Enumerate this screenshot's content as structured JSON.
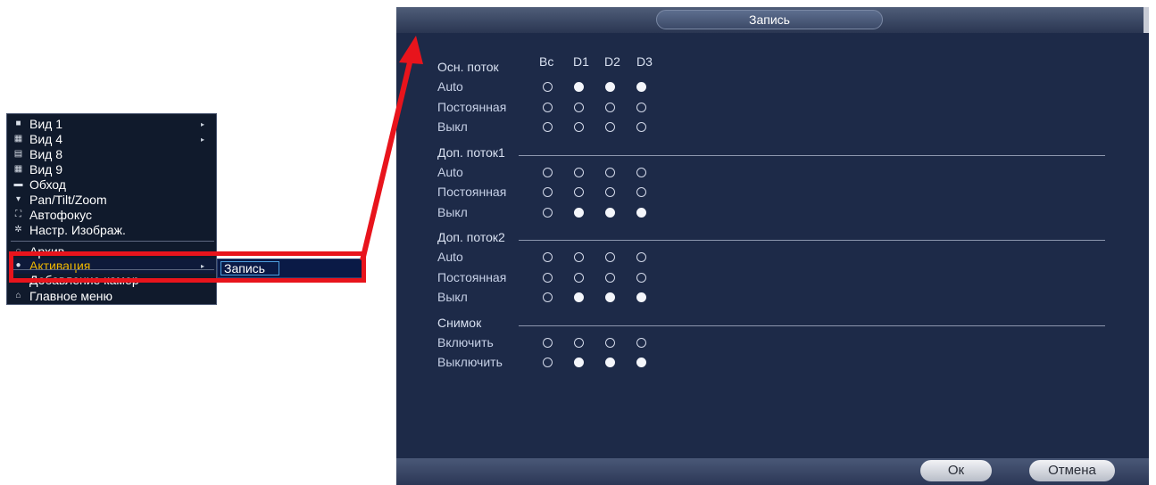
{
  "context_menu": {
    "items": [
      {
        "icon": "grid-1-icon",
        "label": "Вид 1",
        "submenu": true
      },
      {
        "icon": "grid-4-icon",
        "label": "Вид 4",
        "submenu": true
      },
      {
        "icon": "grid-8-icon",
        "label": "Вид 8",
        "submenu": false
      },
      {
        "icon": "grid-9-icon",
        "label": "Вид 9",
        "submenu": false
      },
      {
        "icon": "tour-icon",
        "label": "Обход",
        "submenu": false
      },
      {
        "icon": "ptz-icon",
        "label": "Pan/Tilt/Zoom",
        "submenu": false
      },
      {
        "icon": "autofocus-icon",
        "label": "Автофокус",
        "submenu": false
      },
      {
        "icon": "image-settings-icon",
        "label": "Настр. Изображ.",
        "submenu": false
      },
      {
        "icon": "search-icon",
        "label": "Архив",
        "submenu": false
      },
      {
        "icon": "activation-icon",
        "label": "Активация",
        "submenu": true
      },
      {
        "icon": "add-camera-icon",
        "label": "Добавление камер",
        "submenu": false
      },
      {
        "icon": "home-icon",
        "label": "Главное меню",
        "submenu": false
      }
    ],
    "highlighted_index": 9,
    "submenu": {
      "label": "Запись"
    }
  },
  "dialog": {
    "title": "Запись",
    "columns": [
      "Вс",
      "D1",
      "D2",
      "D3"
    ],
    "sections": [
      {
        "label": "Осн. поток",
        "rows": [
          {
            "label": "Auto",
            "values": [
              false,
              true,
              true,
              true
            ]
          },
          {
            "label": "Постоянная",
            "values": [
              false,
              false,
              false,
              false
            ]
          },
          {
            "label": "Выкл",
            "values": [
              false,
              false,
              false,
              false
            ]
          }
        ]
      },
      {
        "label": "Доп. поток1",
        "rows": [
          {
            "label": "Auto",
            "values": [
              false,
              false,
              false,
              false
            ]
          },
          {
            "label": "Постоянная",
            "values": [
              false,
              false,
              false,
              false
            ]
          },
          {
            "label": "Выкл",
            "values": [
              false,
              true,
              true,
              true
            ]
          }
        ]
      },
      {
        "label": "Доп. поток2",
        "rows": [
          {
            "label": "Auto",
            "values": [
              false,
              false,
              false,
              false
            ]
          },
          {
            "label": "Постоянная",
            "values": [
              false,
              false,
              false,
              false
            ]
          },
          {
            "label": "Выкл",
            "values": [
              false,
              true,
              true,
              true
            ]
          }
        ]
      },
      {
        "label": "Снимок",
        "rows": [
          {
            "label": "Включить",
            "values": [
              false,
              false,
              false,
              false
            ]
          },
          {
            "label": "Выключить",
            "values": [
              false,
              true,
              true,
              true
            ]
          }
        ]
      }
    ],
    "ok_label": "Ок",
    "cancel_label": "Отмена"
  },
  "colors": {
    "annotation_red": "#e8141c",
    "highlight_text": "#f0b800",
    "dialog_bg": "#1d2a48"
  }
}
